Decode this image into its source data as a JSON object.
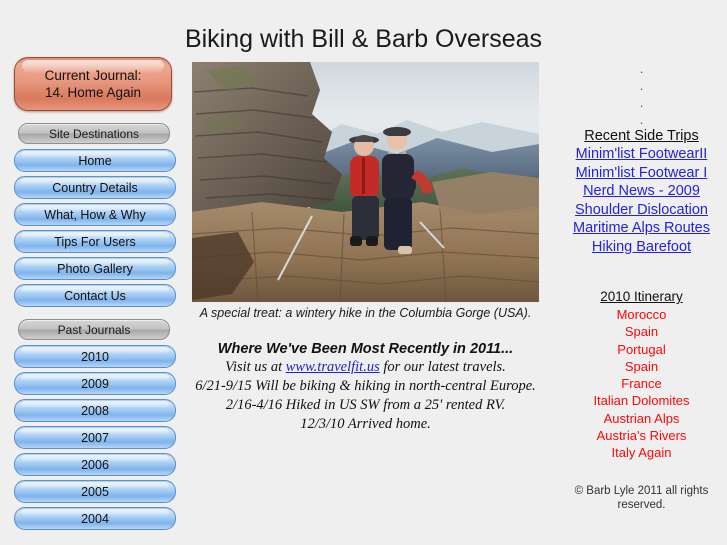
{
  "page": {
    "title": "Biking with Bill & Barb Overseas",
    "background_color": "#efefef"
  },
  "colors": {
    "link_blue": "#2323d8",
    "itinerary_red": "#fb0808",
    "current_journal_button": "#e08a71",
    "nav_button_blue": "#9cc6f2",
    "nav_header_gray": "#c3c3c3"
  },
  "left_sidebar": {
    "current_journal": {
      "line1": "Current Journal:",
      "line2": "14. Home Again"
    },
    "groups": [
      {
        "header": "Site Destinations",
        "items": [
          {
            "label": "Home"
          },
          {
            "label": "Country Details"
          },
          {
            "label": "What, How & Why"
          },
          {
            "label": "Tips For Users"
          },
          {
            "label": "Photo Gallery"
          },
          {
            "label": "Contact Us"
          }
        ]
      },
      {
        "header": "Past Journals",
        "items": [
          {
            "label": "2010"
          },
          {
            "label": "2009"
          },
          {
            "label": "2008"
          },
          {
            "label": "2007"
          },
          {
            "label": "2006"
          },
          {
            "label": "2005"
          },
          {
            "label": "2004"
          }
        ]
      }
    ]
  },
  "center": {
    "photo": {
      "alt": "A couple seated on rock outcrop overlooking a gorge",
      "caption": "A special treat: a wintery hike in the Columbia Gorge (USA)."
    },
    "recent_heading": "Where We've Been Most Recently in 2011...",
    "recent_lines": [
      {
        "before": "Visit us at ",
        "link": "www.travelfit.us",
        "after": " for our latest travels."
      },
      {
        "before": "6/21-9/15 Will be biking & hiking in north-central Europe.",
        "link": "",
        "after": ""
      },
      {
        "before": "2/16-4/16 Hiked in US SW from a 25' rented RV.",
        "link": "",
        "after": ""
      },
      {
        "before": "12/3/10 Arrived home.",
        "link": "",
        "after": ""
      }
    ]
  },
  "right_sidebar": {
    "spacer_dots": [
      ".",
      ".",
      ".",
      "."
    ],
    "side_trips": {
      "heading": "Recent Side Trips",
      "links": [
        {
          "label": "Minim'list FootwearII"
        },
        {
          "label": "Minim'list Footwear I"
        },
        {
          "label": "Nerd News - 2009"
        },
        {
          "label": "Shoulder Dislocation"
        },
        {
          "label": "Maritime Alps Routes"
        },
        {
          "label": "Hiking Barefoot"
        }
      ]
    },
    "itinerary": {
      "heading": "2010 Itinerary",
      "items": [
        {
          "label": "Morocco"
        },
        {
          "label": "Spain"
        },
        {
          "label": "Portugal"
        },
        {
          "label": "Spain"
        },
        {
          "label": "France"
        },
        {
          "label": "Italian Dolomites"
        },
        {
          "label": "Austrian Alps"
        },
        {
          "label": "Austria's Rivers"
        },
        {
          "label": "Italy Again"
        }
      ]
    },
    "copyright": "© Barb Lyle 2011 all rights reserved."
  }
}
